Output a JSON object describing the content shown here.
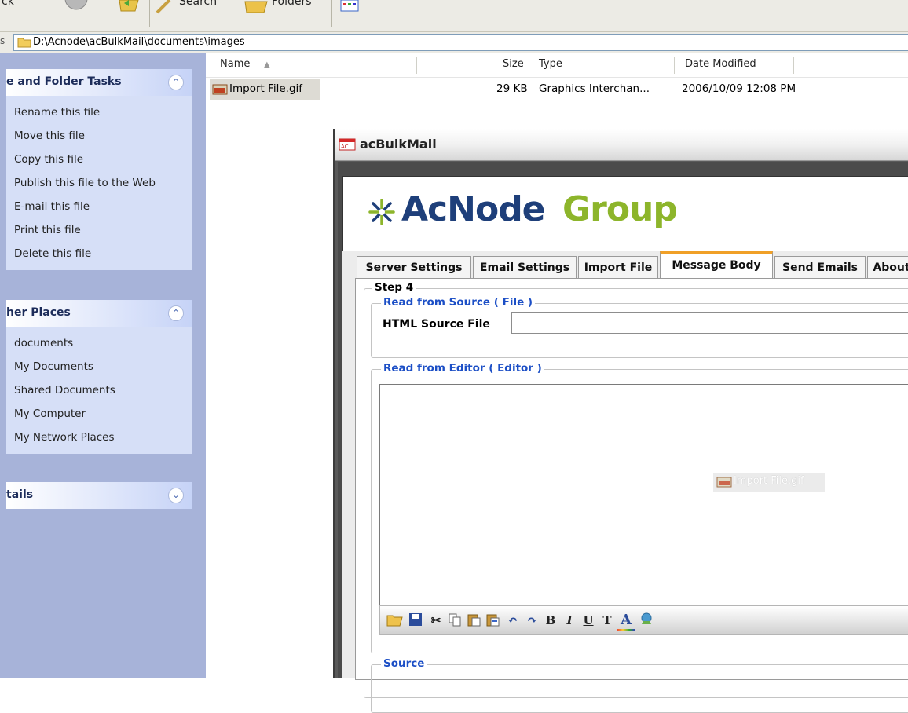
{
  "toolbar": {
    "search_label": "Search",
    "folders_label": "Folders",
    "left_label": "ck"
  },
  "address": {
    "label": "s",
    "path": "D:\\Acnode\\acBulkMail\\documents\\images"
  },
  "task_pane": {
    "file_tasks": {
      "title": "e and Folder Tasks",
      "items": [
        "Rename this file",
        "Move this file",
        "Copy this file",
        "Publish this file to the Web",
        "E-mail this file",
        "Print this file",
        "Delete this file"
      ]
    },
    "other_places": {
      "title": "her Places",
      "items": [
        "documents",
        "My Documents",
        "Shared Documents",
        "My Computer",
        "My Network Places"
      ]
    },
    "details": {
      "title": "tails"
    }
  },
  "file_list": {
    "columns": {
      "name": "Name",
      "size": "Size",
      "type": "Type",
      "date": "Date Modified"
    },
    "rows": [
      {
        "name": "Import File.gif",
        "size": "29 KB",
        "type": "Graphics Interchan...",
        "date": "2006/10/09 12:08 PM"
      }
    ]
  },
  "app": {
    "title": "acBulkMail",
    "logo_part1": "AcNode",
    "logo_part2": "Group",
    "tabs": [
      "Server Settings",
      "Email Settings",
      "Import File",
      "Message Body",
      "Send Emails",
      "About"
    ],
    "active_tab": "Message Body",
    "step_legend": "Step 4",
    "source_file_legend": "Read from Source ( File )",
    "html_source_label": "HTML Source File",
    "html_source_value": "",
    "editor_legend": "Read from Editor ( Editor )",
    "dragged_file": "Import File.gif",
    "source_legend": "Source",
    "editor_buttons": [
      "open-icon",
      "save-icon",
      "cut-icon",
      "copy-icon",
      "paste-icon",
      "paste-special-icon",
      "undo-icon",
      "redo-icon",
      "B",
      "I",
      "U",
      "T",
      "A",
      "insert-link-icon"
    ]
  },
  "colors": {
    "accent_blue": "#1c4fc6",
    "logo_blue": "#1e3f7a",
    "logo_green": "#8db52b",
    "active_tab_orange": "#f0a028"
  }
}
